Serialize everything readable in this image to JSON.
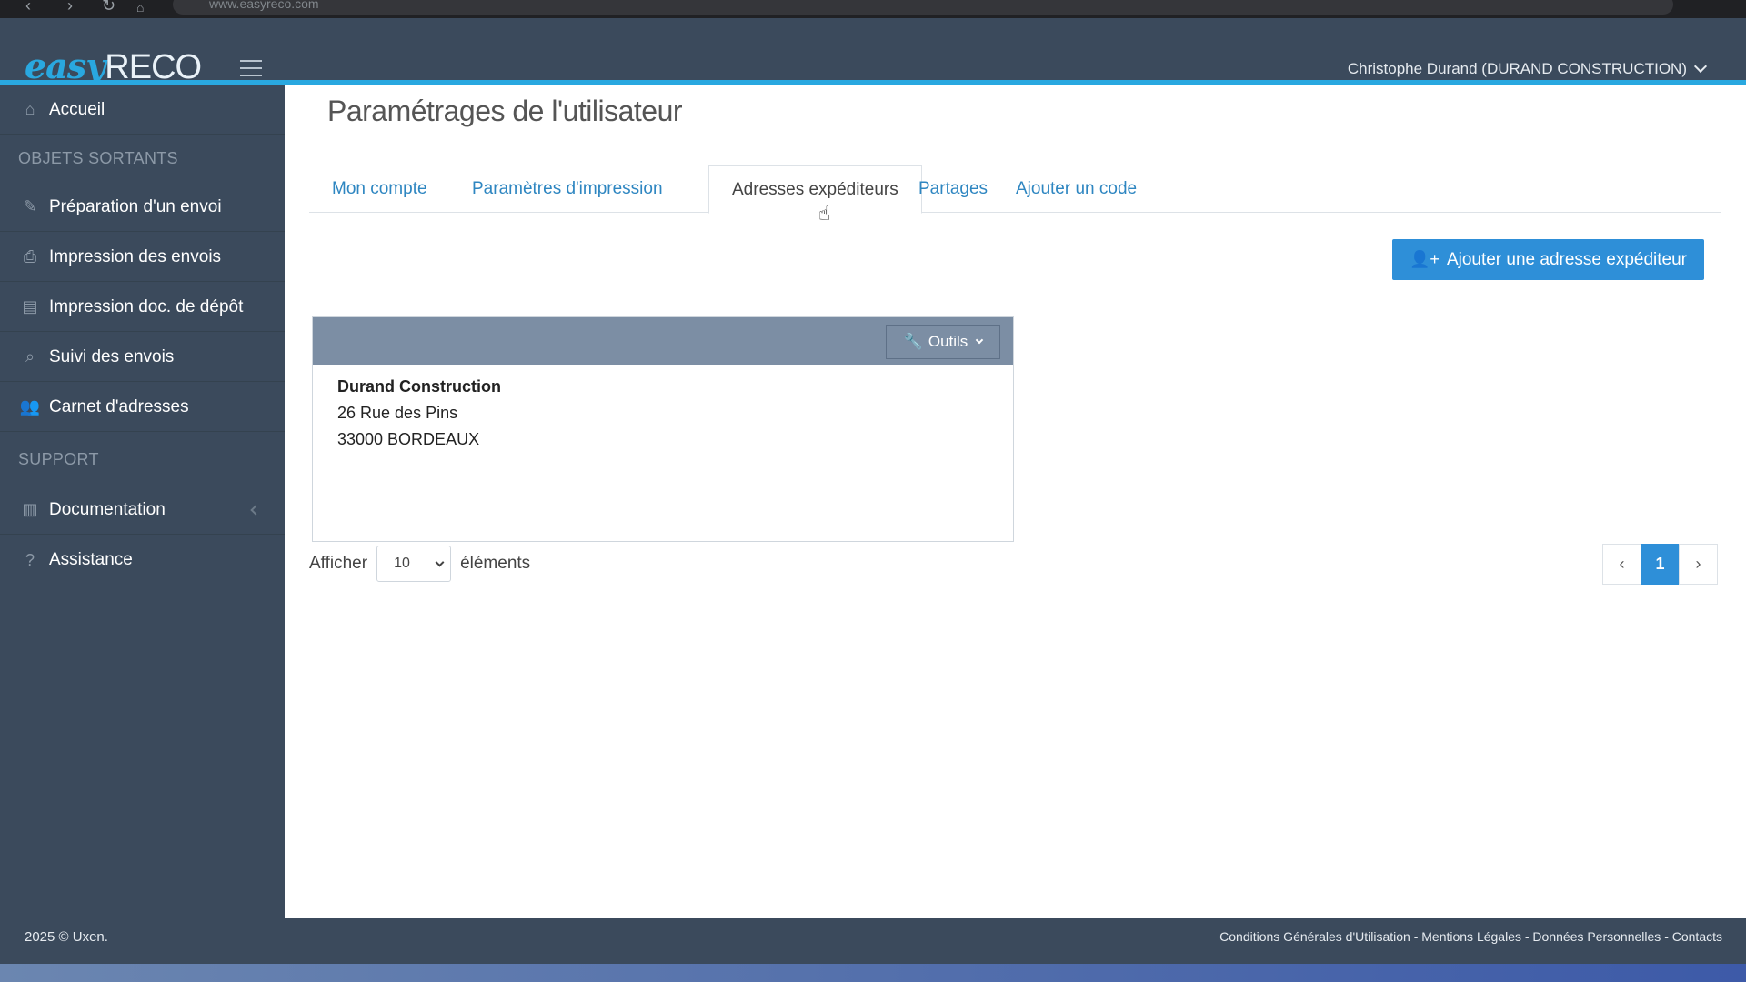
{
  "browser": {
    "url": "www.easyreco.com"
  },
  "header": {
    "logo_part1": "easy",
    "logo_part2": "RECO",
    "user": "Christophe Durand (DURAND CONSTRUCTION)"
  },
  "sidebar": {
    "home": "Accueil",
    "section_outgoing": "OBJETS SORTANTS",
    "items": [
      {
        "label": "Préparation d'un envoi",
        "icon": "pencil-icon"
      },
      {
        "label": "Impression des envois",
        "icon": "printer-icon"
      },
      {
        "label": "Impression doc. de dépôt",
        "icon": "document-icon"
      },
      {
        "label": "Suivi des envois",
        "icon": "search-icon"
      },
      {
        "label": "Carnet d'adresses",
        "icon": "users-icon"
      }
    ],
    "section_support": "SUPPORT",
    "support_items": [
      {
        "label": "Documentation",
        "icon": "book-icon"
      },
      {
        "label": "Assistance",
        "icon": "help-icon"
      }
    ]
  },
  "main": {
    "title": "Paramétrages de l'utilisateur",
    "tabs": [
      {
        "label": "Mon compte"
      },
      {
        "label": "Paramètres d'impression"
      },
      {
        "label": "Adresses expéditeurs",
        "active": true
      },
      {
        "label": "Partages"
      },
      {
        "label": "Ajouter un code"
      }
    ],
    "add_button": "Ajouter une adresse expéditeur",
    "card": {
      "tools_label": "Outils",
      "name": "Durand Construction",
      "street": "26 Rue des Pins",
      "city": "33000 BORDEAUX"
    },
    "show_label": "Afficher",
    "page_size": "10",
    "elements_label": "éléments",
    "pagination": {
      "prev": "‹",
      "current": "1",
      "next": "›"
    }
  },
  "footer": {
    "copyright": "2025 © Uxen.",
    "links": "Conditions Générales d'Utilisation - Mentions Légales - Données Personnelles - Contacts"
  },
  "colors": {
    "accent": "#29a8e0",
    "primary_button": "#2e8fd8",
    "sidebar_bg": "#3b4a5c"
  }
}
